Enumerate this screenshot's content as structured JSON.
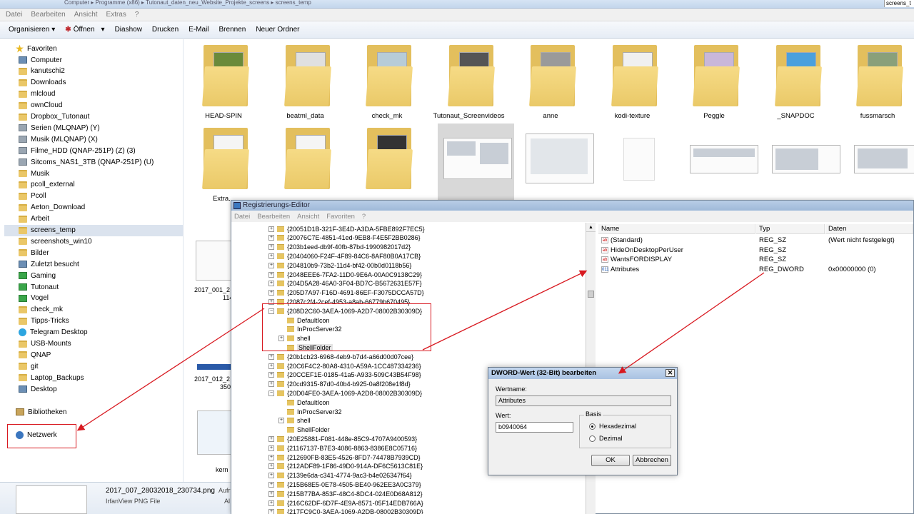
{
  "explorer": {
    "title_strip": "Computer ▸ Programme (x86) ▸ Tutonaut_daten_neu_Website_Projekte_screens ▸ screens_temp",
    "search_value": "screens_t",
    "menu": [
      "Datei",
      "Bearbeiten",
      "Ansicht",
      "Extras",
      "?"
    ],
    "toolbar": [
      "Organisieren",
      "Öffnen",
      "Diashow",
      "Drucken",
      "E-Mail",
      "Brennen",
      "Neuer Ordner"
    ],
    "nav": {
      "favorites_header": "Favoriten",
      "items": [
        {
          "label": "Computer",
          "icon": "computer-icon"
        },
        {
          "label": "kanutschi2",
          "icon": "folder-icon"
        },
        {
          "label": "Downloads",
          "icon": "folder-icon"
        },
        {
          "label": "mlcloud",
          "icon": "folder-icon"
        },
        {
          "label": "ownCloud",
          "icon": "folder-icon"
        },
        {
          "label": "Dropbox_Tutonaut",
          "icon": "folder-icon"
        },
        {
          "label": "Serien (MLQNAP) (Y)",
          "icon": "drive-icon"
        },
        {
          "label": "Musik (MLQNAP) (X)",
          "icon": "drive-icon"
        },
        {
          "label": "Filme_HDD (QNAP-251P) (Z) (3)",
          "icon": "drive-icon"
        },
        {
          "label": "Sitcoms_NAS1_3TB (QNAP-251P) (U)",
          "icon": "drive-icon"
        },
        {
          "label": "Musik",
          "icon": "folder-icon"
        },
        {
          "label": "pcoll_external",
          "icon": "folder-icon"
        },
        {
          "label": "Pcoll",
          "icon": "folder-icon"
        },
        {
          "label": "Aeton_Download",
          "icon": "folder-icon"
        },
        {
          "label": "Arbeit",
          "icon": "folder-icon"
        },
        {
          "label": "screens_temp",
          "icon": "folder-icon"
        },
        {
          "label": "screenshots_win10",
          "icon": "folder-icon"
        },
        {
          "label": "Bilder",
          "icon": "folder-icon"
        },
        {
          "label": "Zuletzt besucht",
          "icon": "recent-icon"
        },
        {
          "label": "Gaming",
          "icon": "green-folder-icon"
        },
        {
          "label": "Tutonaut",
          "icon": "green-folder-icon"
        },
        {
          "label": "Vogel",
          "icon": "green-folder-icon"
        },
        {
          "label": "check_mk",
          "icon": "folder-icon"
        },
        {
          "label": "Tipps-Tricks",
          "icon": "folder-icon"
        },
        {
          "label": "Telegram Desktop",
          "icon": "telegram-icon"
        },
        {
          "label": "USB-Mounts",
          "icon": "folder-icon"
        },
        {
          "label": "QNAP",
          "icon": "folder-icon"
        },
        {
          "label": "git",
          "icon": "folder-icon"
        },
        {
          "label": "Laptop_Backups",
          "icon": "folder-icon"
        },
        {
          "label": "Desktop",
          "icon": "desktop-icon"
        }
      ],
      "libraries": "Bibliotheken",
      "network": "Netzwerk"
    },
    "row1": [
      "HEAD-SPIN",
      "beatml_data",
      "check_mk",
      "Tutonaut_Screenvideos",
      "anne",
      "kodi-texture",
      "Peggle",
      "_SNAPDOC",
      "fussmarsch"
    ],
    "row2_partial_labels": [
      "Extra..."
    ],
    "left_col_labels": [
      "2017_001_2",
      "114",
      "2017_012_2",
      "350",
      "kern"
    ],
    "detail": {
      "filename": "2017_007_28032018_230734.png",
      "type": "IrfanView PNG File",
      "extra1": "Aufr",
      "extra2": "Al"
    }
  },
  "registry": {
    "title": "Registrierungs-Editor",
    "menu": [
      "Datei",
      "Bearbeiten",
      "Ansicht",
      "Favoriten",
      "?"
    ],
    "tree": [
      {
        "label": "{20051D1B-321F-3E4D-A3DA-5FBE892F7EC5}",
        "exp": "+"
      },
      {
        "label": "{20076C7E-4851-41ed-9EB8-F4E5F2BB0286}",
        "exp": "+"
      },
      {
        "label": "{203b1eed-db9f-40fb-87bd-1990982017d2}",
        "exp": "+"
      },
      {
        "label": "{20404060-F24F-4F89-84C6-8AF80B0A17CB}",
        "exp": "+"
      },
      {
        "label": "{204810b9-73b2-11d4-bf42-00b0d0118b56}",
        "exp": "+"
      },
      {
        "label": "{2048EEE6-7FA2-11D0-9E6A-00A0C9138C29}",
        "exp": "+"
      },
      {
        "label": "{204D5A28-46A0-3F04-BD7C-B5672631E57F}",
        "exp": "+"
      },
      {
        "label": "{205D7A97-F16D-4691-86EF-F3075DCCA57D}",
        "exp": "+"
      },
      {
        "label": "{2087c2f4-2cef-4953-a8ab-66779b670495}",
        "exp": "+"
      },
      {
        "label": "{208D2C60-3AEA-1069-A2D7-08002B30309D}",
        "exp": "-"
      },
      {
        "label": "DefaultIcon",
        "child": true
      },
      {
        "label": "InProcServer32",
        "child": true
      },
      {
        "label": "shell",
        "child": true,
        "exp": "+"
      },
      {
        "label": "ShellFolder",
        "child": true,
        "sel": true
      },
      {
        "label": "{20b1cb23-6968-4eb9-b7d4-a66d00d07cee}",
        "exp": "+"
      },
      {
        "label": "{20C6F4C2-80A8-4310-A59A-1CC487334236}",
        "exp": "+"
      },
      {
        "label": "{20CCEF1E-0185-41a5-A933-509C43B54F98}",
        "exp": "+"
      },
      {
        "label": "{20cd9315-87d0-40b4-b925-0a8f208e1f8d}",
        "exp": "+"
      },
      {
        "label": "{20D04FE0-3AEA-1069-A2D8-08002B30309D}",
        "exp": "-"
      },
      {
        "label": "DefaultIcon",
        "child": true
      },
      {
        "label": "InProcServer32",
        "child": true
      },
      {
        "label": "shell",
        "child": true,
        "exp": "+"
      },
      {
        "label": "ShellFolder",
        "child": true
      },
      {
        "label": "{20E25881-F081-448e-85C9-4707A9400593}",
        "exp": "+"
      },
      {
        "label": "{21167137-B7E3-4086-8863-8386E8C05716}",
        "exp": "+"
      },
      {
        "label": "{212690FB-83E5-4526-8FD7-74478B7939CD}",
        "exp": "+"
      },
      {
        "label": "{212ADF89-1F86-49D0-914A-DF6C5613C81E}",
        "exp": "+"
      },
      {
        "label": "{2139e6da-c341-4774-9ac3-b4e026347f64}",
        "exp": "+"
      },
      {
        "label": "{215B68E5-0E78-4505-BE40-962EE3A0C379}",
        "exp": "+"
      },
      {
        "label": "{215B77BA-853F-48C4-8DC4-024E0D68A812}",
        "exp": "+"
      },
      {
        "label": "{216C62DF-6D7F-4E9A-8571-05F14EDB766A}",
        "exp": "+"
      },
      {
        "label": "{217FC9C0-3AEA-1069-A2DB-08002B30309D}",
        "exp": "+"
      }
    ],
    "columns": [
      "Name",
      "Typ",
      "Daten"
    ],
    "values": [
      {
        "name": "(Standard)",
        "type": "REG_SZ",
        "data": "(Wert nicht festgelegt)",
        "icon": "ab"
      },
      {
        "name": "HideOnDesktopPerUser",
        "type": "REG_SZ",
        "data": "",
        "icon": "ab"
      },
      {
        "name": "WantsFORDISPLAY",
        "type": "REG_SZ",
        "data": "",
        "icon": "ab"
      },
      {
        "name": "Attributes",
        "type": "REG_DWORD",
        "data": "0x00000000 (0)",
        "icon": "bin"
      }
    ]
  },
  "dialog": {
    "title": "DWORD-Wert (32-Bit) bearbeiten",
    "name_label": "Wertname:",
    "name_value": "Attributes",
    "value_label": "Wert:",
    "value": "b0940064",
    "basis_label": "Basis",
    "hex": "Hexadezimal",
    "dec": "Dezimal",
    "ok": "OK",
    "cancel": "Abbrechen"
  },
  "colors": {
    "annotation": "#d81920",
    "folder": "#eac768",
    "selection": "#dbe3ee"
  }
}
